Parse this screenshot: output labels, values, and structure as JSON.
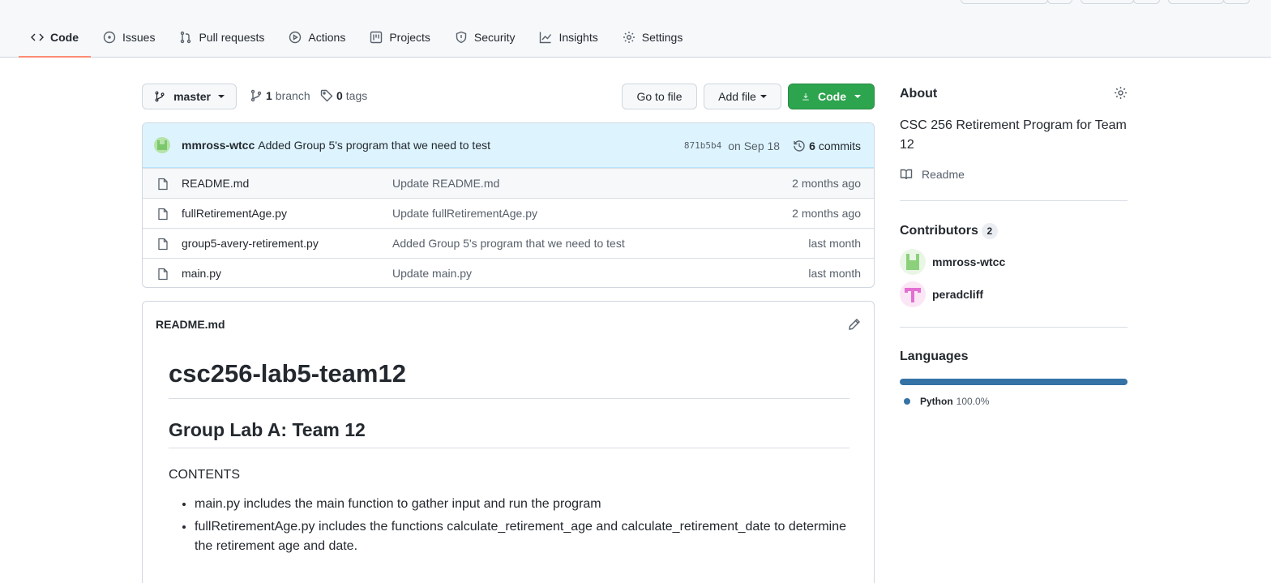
{
  "nav": {
    "tabs": [
      {
        "label": "Code",
        "icon": "code-icon"
      },
      {
        "label": "Issues",
        "icon": "issue-icon"
      },
      {
        "label": "Pull requests",
        "icon": "pull-request-icon"
      },
      {
        "label": "Actions",
        "icon": "play-icon"
      },
      {
        "label": "Projects",
        "icon": "project-icon"
      },
      {
        "label": "Security",
        "icon": "shield-icon"
      },
      {
        "label": "Insights",
        "icon": "graph-icon"
      },
      {
        "label": "Settings",
        "icon": "gear-icon"
      }
    ]
  },
  "toolbar": {
    "branch": "master",
    "branch_count": "1",
    "branch_label": "branch",
    "tag_count": "0",
    "tag_label": "tags",
    "go_to_file": "Go to file",
    "add_file": "Add file",
    "code": "Code"
  },
  "latest_commit": {
    "author": "mmross-wtcc",
    "message": "Added Group 5's program that we need to test",
    "sha": "871b5b4",
    "date": "on Sep 18",
    "commit_count": "6",
    "commit_label": "commits"
  },
  "files": [
    {
      "name": "README.md",
      "message": "Update README.md",
      "age": "2 months ago"
    },
    {
      "name": "fullRetirementAge.py",
      "message": "Update fullRetirementAge.py",
      "age": "2 months ago"
    },
    {
      "name": "group5-avery-retirement.py",
      "message": "Added Group 5's program that we need to test",
      "age": "last month"
    },
    {
      "name": "main.py",
      "message": "Update main.py",
      "age": "last month"
    }
  ],
  "readme": {
    "filename": "README.md",
    "h1": "csc256-lab5-team12",
    "h2": "Group Lab A: Team 12",
    "contents_label": "CONTENTS",
    "items": [
      "main.py includes the main function to gather input and run the program",
      "fullRetirementAge.py includes the functions calculate_retirement_age and calculate_retirement_date to determine the retirement age and date."
    ]
  },
  "sidebar": {
    "about_title": "About",
    "description": "CSC 256 Retirement Program for Team 12",
    "readme_link": "Readme",
    "contributors_title": "Contributors",
    "contributors_count": "2",
    "contributors": [
      {
        "name": "mmross-wtcc"
      },
      {
        "name": "peradcliff"
      }
    ],
    "languages_title": "Languages",
    "languages": [
      {
        "name": "Python",
        "percent": "100.0%",
        "color": "#3572a5",
        "share": 1.0
      }
    ]
  },
  "colors": {
    "accent_tab": "#fd8c73",
    "primary_button": "#2da44e",
    "commit_bar": "#ddf4ff"
  }
}
